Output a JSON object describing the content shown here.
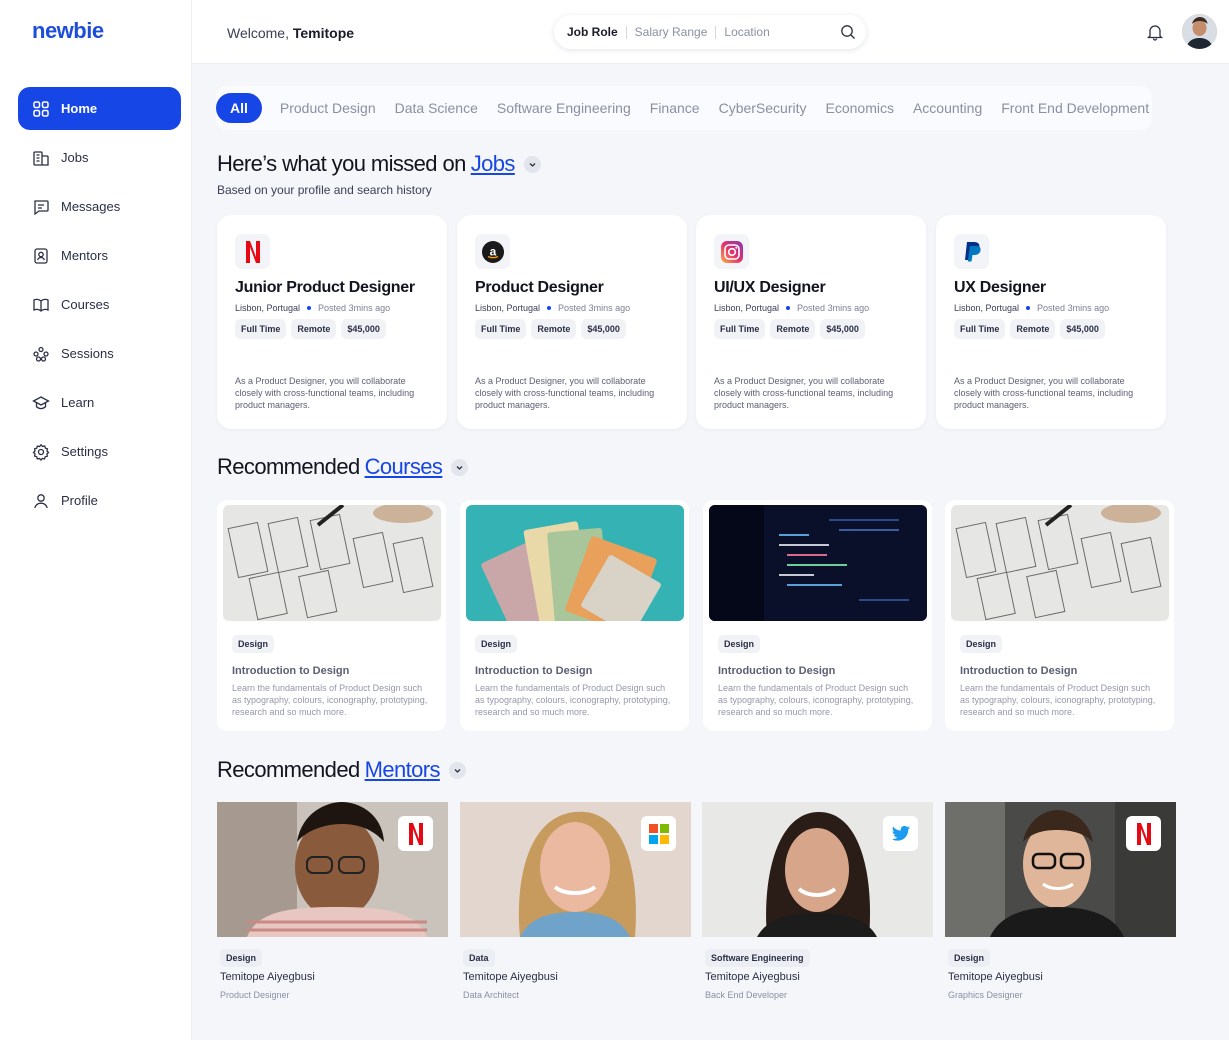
{
  "app": {
    "logo": "newbie"
  },
  "sidebar": {
    "items": [
      {
        "label": "Home",
        "icon": "grid-icon",
        "active": true
      },
      {
        "label": "Jobs",
        "icon": "building-icon"
      },
      {
        "label": "Messages",
        "icon": "chat-icon"
      },
      {
        "label": "Mentors",
        "icon": "badge-icon"
      },
      {
        "label": "Courses",
        "icon": "book-icon"
      },
      {
        "label": "Sessions",
        "icon": "people-icon"
      },
      {
        "label": "Learn",
        "icon": "graduation-icon"
      },
      {
        "label": "Settings",
        "icon": "gear-icon"
      },
      {
        "label": "Profile",
        "icon": "user-icon"
      }
    ]
  },
  "header": {
    "welcome_prefix": "Welcome,",
    "user_name": "Temitope",
    "search": {
      "job_role": "Job Role",
      "salary_range": "Salary Range",
      "location": "Location"
    }
  },
  "tabs": [
    "All",
    "Product Design",
    "Data Science",
    "Software Engineering",
    "Finance",
    "CyberSecurity",
    "Economics",
    "Accounting",
    "Front End Development"
  ],
  "jobs_section": {
    "title_prefix": "Here’s what you missed on",
    "title_link": "Jobs",
    "subtitle": "Based on your profile and search history",
    "cards": [
      {
        "logo": "netflix-logo",
        "title": "Junior Product Designer",
        "location": "Lisbon, Portugal",
        "posted": "Posted 3mins ago",
        "tags": [
          "Full Time",
          "Remote",
          "$45,000"
        ],
        "desc": "As a Product Designer, you will collaborate closely with cross-functional teams, including product managers."
      },
      {
        "logo": "amazon-logo",
        "title": "Product Designer",
        "location": "Lisbon, Portugal",
        "posted": "Posted 3mins ago",
        "tags": [
          "Full Time",
          "Remote",
          "$45,000"
        ],
        "desc": "As a Product Designer, you will collaborate closely with cross-functional teams, including product managers."
      },
      {
        "logo": "instagram-logo",
        "title": "UI/UX Designer",
        "location": "Lisbon, Portugal",
        "posted": "Posted 3mins ago",
        "tags": [
          "Full Time",
          "Remote",
          "$45,000"
        ],
        "desc": "As a Product Designer, you will collaborate closely with cross-functional teams, including product managers."
      },
      {
        "logo": "paypal-logo",
        "title": "UX Designer",
        "location": "Lisbon, Portugal",
        "posted": "Posted 3mins ago",
        "tags": [
          "Full Time",
          "Remote",
          "$45,000"
        ],
        "desc": "As a Product Designer, you will collaborate closely with cross-functional teams, including product managers."
      }
    ]
  },
  "courses_section": {
    "title_prefix": "Recommended",
    "title_link": "Courses",
    "cards": [
      {
        "image": "wireframe-sketch",
        "tag": "Design",
        "title": "Introduction to Design",
        "desc": "Learn the fundamentals of Product Design such as typography, colours, iconography, prototyping, research and so much more."
      },
      {
        "image": "money-bills",
        "tag": "Design",
        "title": "Introduction to Design",
        "desc": "Learn the fundamentals of Product Design such as typography, colours, iconography, prototyping, research and so much more."
      },
      {
        "image": "code-screen",
        "tag": "Design",
        "title": "Introduction to Design",
        "desc": "Learn the fundamentals of Product Design such as typography, colours, iconography, prototyping, research and so much more."
      },
      {
        "image": "wireframe-sketch",
        "tag": "Design",
        "title": "Introduction to Design",
        "desc": "Learn the fundamentals of Product Design such as typography, colours, iconography, prototyping, research and so much more."
      }
    ]
  },
  "mentors_section": {
    "title_prefix": "Recommended",
    "title_link": "Mentors",
    "cards": [
      {
        "logo": "netflix-logo",
        "tag": "Design",
        "name": "Temitope Aiyegbusi",
        "role": "Product Designer"
      },
      {
        "logo": "microsoft-logo",
        "tag": "Data",
        "name": "Temitope Aiyegbusi",
        "role": "Data Architect"
      },
      {
        "logo": "twitter-logo",
        "tag": "Software Engineering",
        "name": "Temitope Aiyegbusi",
        "role": "Back End Developer"
      },
      {
        "logo": "netflix-logo",
        "tag": "Design",
        "name": "Temitope Aiyegbusi",
        "role": "Graphics Designer"
      }
    ]
  },
  "colors": {
    "accent": "#1746e6",
    "background": "#f5f6fa",
    "netflix": "#e50914",
    "twitter": "#1d9bf0"
  }
}
